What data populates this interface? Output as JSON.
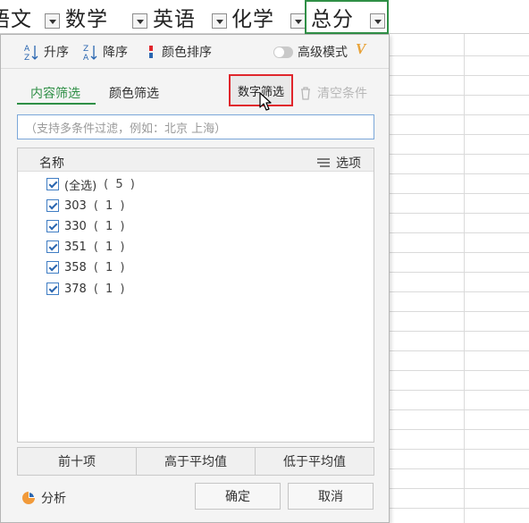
{
  "header": {
    "columns": [
      {
        "label": "语文"
      },
      {
        "label": "数学"
      },
      {
        "label": "英语"
      },
      {
        "label": "化学"
      },
      {
        "label": "总分"
      }
    ]
  },
  "sort": {
    "ascending": "升序",
    "descending": "降序",
    "by_color": "颜色排序",
    "advanced_mode": "高级模式",
    "vip_badge": "V"
  },
  "tabs": {
    "content_filter": "内容筛选",
    "color_filter": "颜色筛选",
    "number_filter": "数字筛选",
    "clear_conditions": "清空条件"
  },
  "search": {
    "placeholder": "（支持多条件过滤，例如：北京  上海）"
  },
  "list": {
    "name_header": "名称",
    "options_label": "选项",
    "items": [
      {
        "label": "(全选)",
        "count": "( 5 )",
        "checked": true
      },
      {
        "label": "303",
        "count": "( 1 )",
        "checked": true
      },
      {
        "label": "330",
        "count": "( 1 )",
        "checked": true
      },
      {
        "label": "351",
        "count": "( 1 )",
        "checked": true
      },
      {
        "label": "358",
        "count": "( 1 )",
        "checked": true
      },
      {
        "label": "378",
        "count": "( 1 )",
        "checked": true
      }
    ]
  },
  "quick_buttons": {
    "top_ten": "前十项",
    "above_average": "高于平均值",
    "below_average": "低于平均值"
  },
  "footer": {
    "analyze": "分析",
    "ok": "确定",
    "cancel": "取消"
  },
  "colors": {
    "accent_green": "#2f8f46",
    "highlight_red": "#e0262c",
    "checkbox_blue": "#2a66b0",
    "vip_orange": "#e8a33a"
  }
}
